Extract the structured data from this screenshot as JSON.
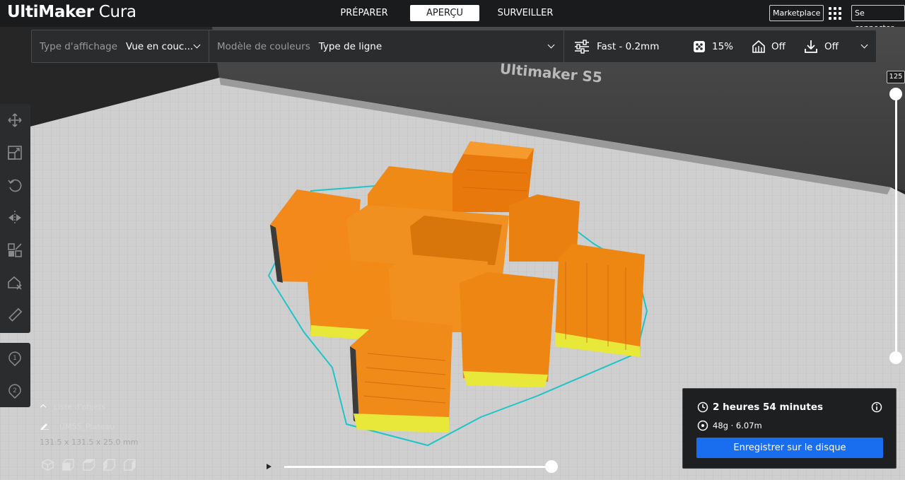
{
  "app": {
    "brand": "UltiMaker",
    "product": "Cura"
  },
  "nav": {
    "tabs": [
      "PRÉPARER",
      "APERÇU",
      "SURVEILLER"
    ],
    "active": "APERÇU"
  },
  "header": {
    "marketplace": "Marketplace",
    "signin": "Se connecter"
  },
  "stage": {
    "view_type_label": "Type d'affichage",
    "view_type_value": "Vue en couc...",
    "color_scheme_label": "Modèle de couleurs",
    "color_scheme_value": "Type de ligne",
    "profile": "Fast - 0.2mm",
    "infill": "15%",
    "support": "Off",
    "adhesion": "Off"
  },
  "printer": {
    "name": "Ultimaker S5"
  },
  "layer_slider": {
    "top_value": "125"
  },
  "objects": {
    "toggle_label": "Liste d'objets",
    "name": "UMS5_Plateau",
    "dimensions": "131.5 x 131.5 x 25.0 mm"
  },
  "estimate": {
    "time": "2 heures 54 minutes",
    "material": "48g · 6.07m",
    "save_label": "Enregistrer sur le disque"
  },
  "colors": {
    "accent": "#196ef0",
    "infill": "#f4860f",
    "skirt": "#1fc4c8",
    "topbar": "#1a1b1d",
    "panel": "#2b2c2e"
  },
  "icons": {
    "tools": [
      "move-icon",
      "scale-icon",
      "rotate-icon",
      "mirror-icon",
      "per-model-settings-icon",
      "support-blocker-icon",
      "measure-icon"
    ],
    "extruders": [
      "extruder-1-icon",
      "extruder-2-icon"
    ],
    "camera_views": [
      "3d-view-icon",
      "front-view-icon",
      "top-view-icon",
      "left-view-icon",
      "right-view-icon"
    ]
  }
}
